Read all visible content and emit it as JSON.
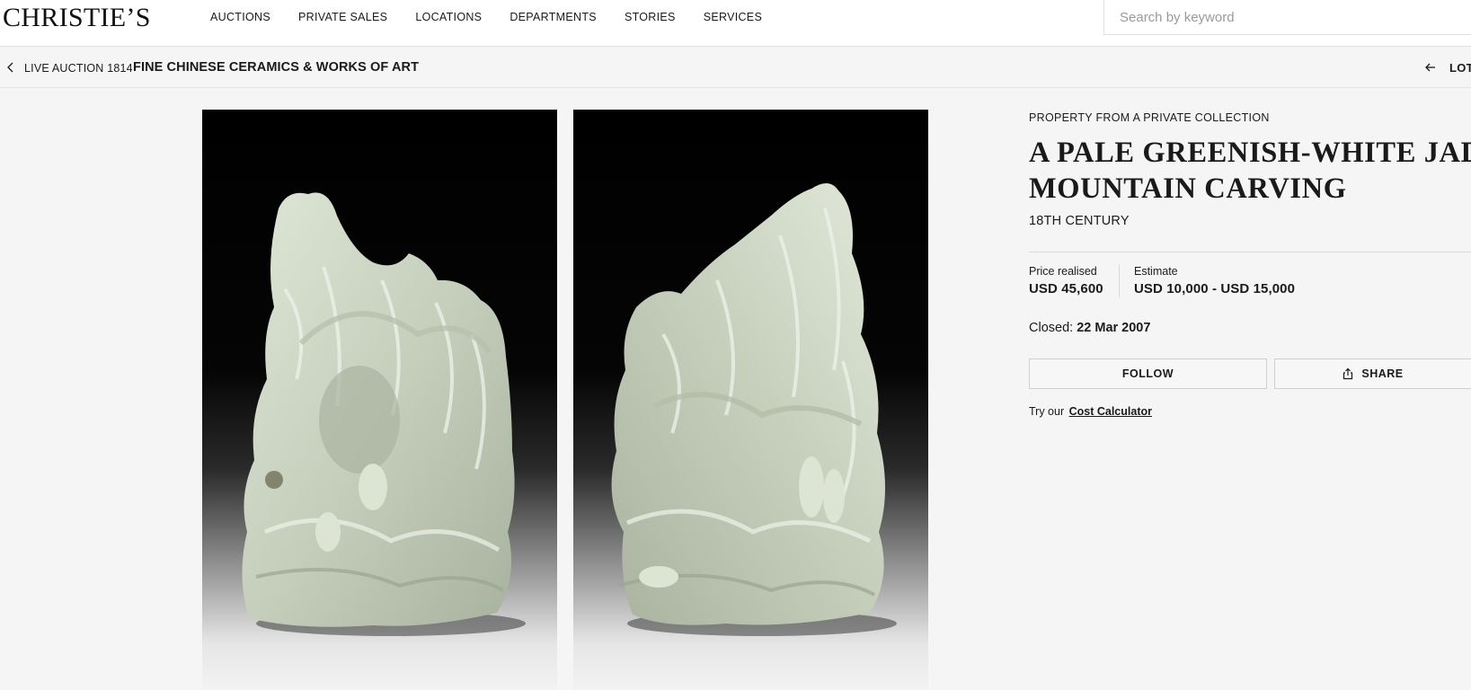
{
  "header": {
    "logo": "CHRISTIE’S",
    "nav": [
      "AUCTIONS",
      "PRIVATE SALES",
      "LOCATIONS",
      "DEPARTMENTS",
      "STORIES",
      "SERVICES"
    ],
    "search_placeholder": "Search by keyword"
  },
  "breadcrumb": {
    "auction_label": "LIVE AUCTION 1814",
    "sale_title": "FINE CHINESE CERAMICS & WORKS OF ART",
    "lot_label": "LOT"
  },
  "lot": {
    "provenance": "PROPERTY FROM A PRIVATE COLLECTION",
    "title_line1": "A PALE GREENISH-WHITE JADE",
    "title_line2": "MOUNTAIN CARVING",
    "period": "18TH CENTURY",
    "price_realised_label": "Price realised",
    "price_realised": "USD 45,600",
    "estimate_label": "Estimate",
    "estimate": "USD 10,000 - USD 15,000",
    "closed_label": "Closed:",
    "closed_date": "22 Mar 2007",
    "follow_label": "FOLLOW",
    "share_label": "SHARE",
    "calc_prefix": "Try our",
    "calc_link": "Cost Calculator"
  },
  "icons": {
    "back": "chevron-left-icon",
    "lot_nav": "arrow-left-icon",
    "share": "share-icon"
  },
  "colors": {
    "page_bg": "#f5f5f5",
    "text": "#1a1a1a",
    "border": "#e2e2e2"
  }
}
